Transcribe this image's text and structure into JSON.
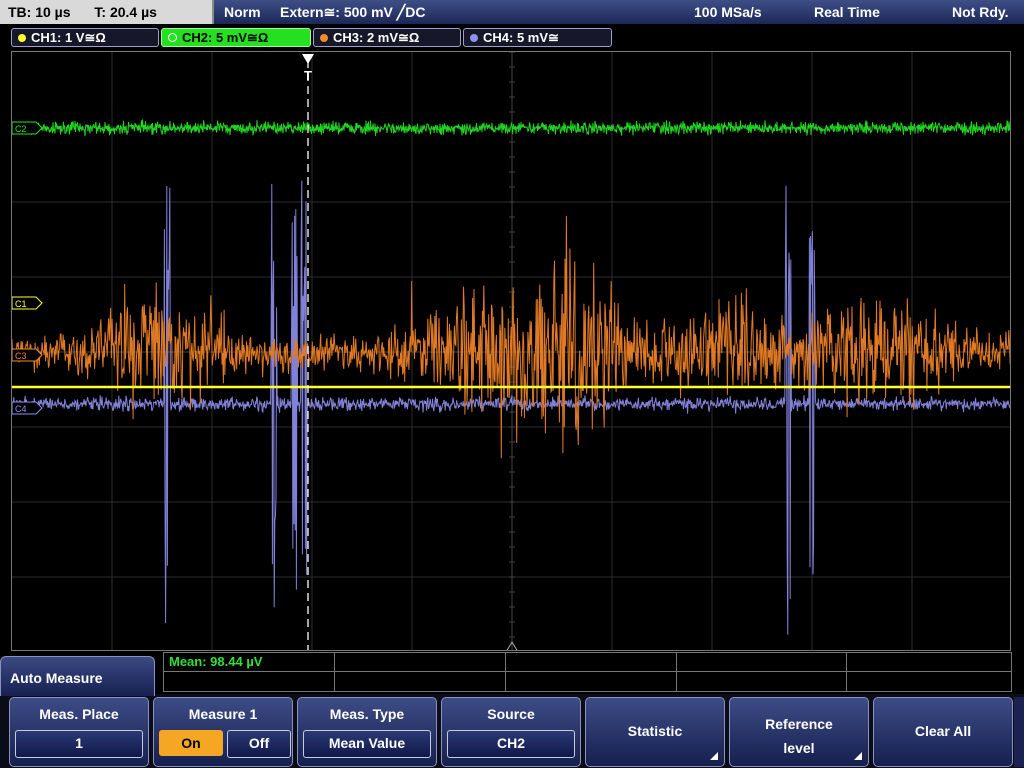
{
  "status": {
    "timebase": "TB: 10 µs",
    "trigger_time": "T: 20.4 µs",
    "mode": "Norm",
    "trigger_source": "Extern≅: 500 mV ╱DC",
    "sample_rate": "100 MSa/s",
    "acq_mode": "Real Time",
    "ready_state": "Not Rdy."
  },
  "channels": [
    {
      "label": "CH1: 1 V≅Ω",
      "color": "#ffff33"
    },
    {
      "label": "CH2: 5 mV≅Ω",
      "color": "#23e623",
      "active": true
    },
    {
      "label": "CH3: 2 mV≅Ω",
      "color": "#f08a2d"
    },
    {
      "label": "CH4: 5 mV≅",
      "color": "#8f8ff0"
    }
  ],
  "markers": {
    "trigger": "T",
    "ch2": "C2",
    "ch1": "C1",
    "ch3": "C3",
    "ch4": "C4"
  },
  "measurement": {
    "mean_readout": "Mean: 98.44 µV"
  },
  "menu": {
    "title": "Auto Measure",
    "meas_place_label": "Meas. Place",
    "meas_place_value": "1",
    "measure1_label": "Measure 1",
    "on_label": "On",
    "off_label": "Off",
    "meas_type_label": "Meas. Type",
    "meas_type_value": "Mean Value",
    "source_label": "Source",
    "source_value": "CH2",
    "statistic_label": "Statistic",
    "reference_label_1": "Reference",
    "reference_label_2": "level",
    "clear_all_label": "Clear All"
  }
}
